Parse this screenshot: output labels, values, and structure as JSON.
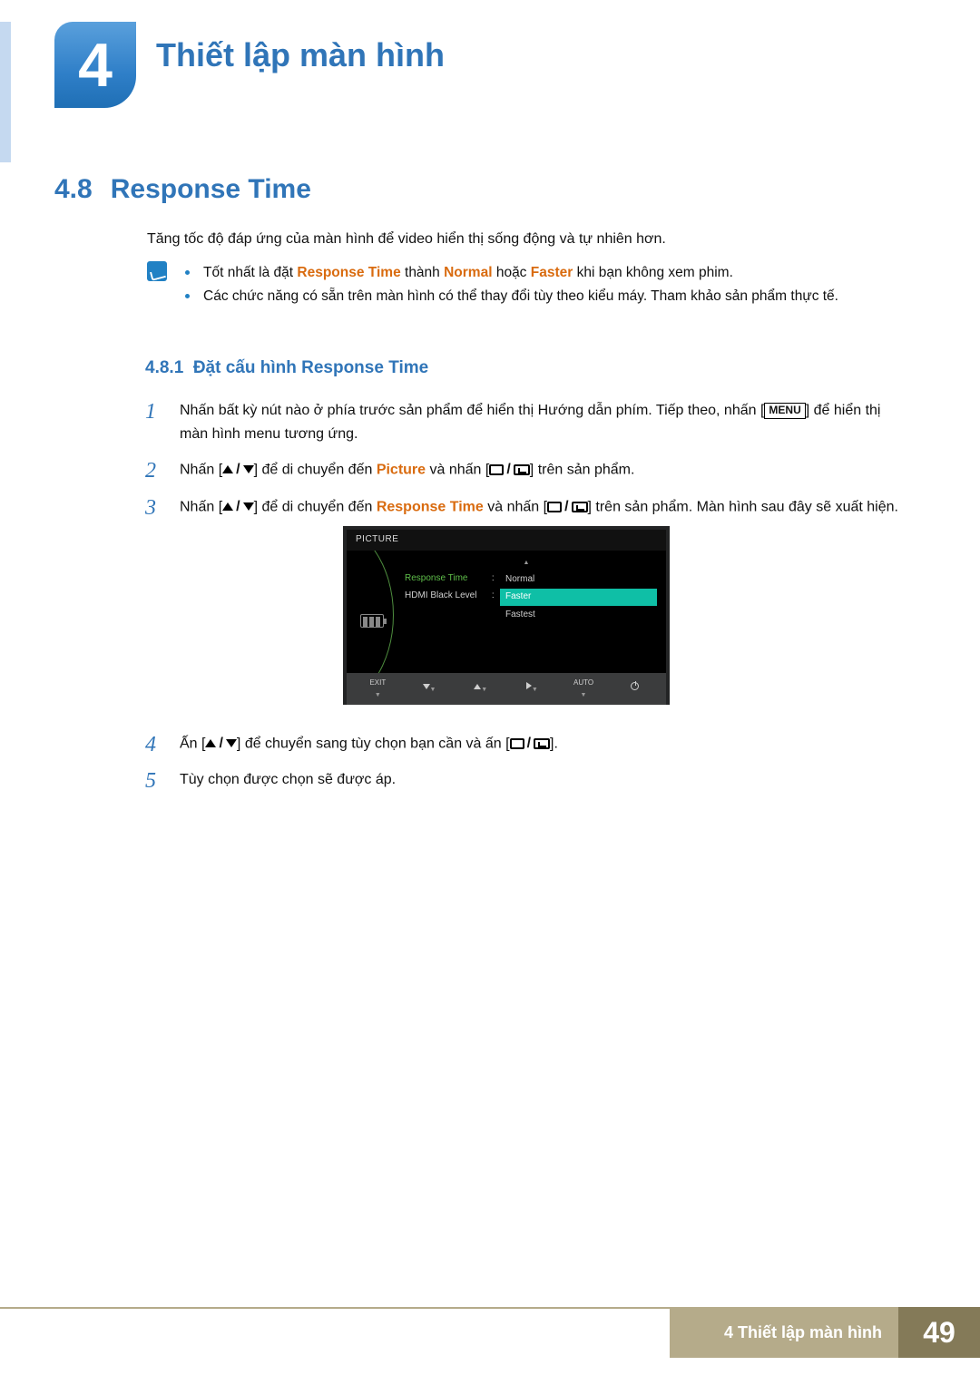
{
  "chapter": {
    "number": "4",
    "title": "Thiết lập màn hình"
  },
  "section": {
    "number": "4.8",
    "title": "Response Time"
  },
  "intro": "Tăng tốc độ đáp ứng của màn hình để video hiển thị sống động và tự nhiên hơn.",
  "note": {
    "items": [
      {
        "pre": "Tốt nhất là đặt ",
        "b1": "Response Time",
        "mid1": " thành ",
        "b2": "Normal",
        "mid2": " hoặc ",
        "b3": "Faster",
        "post": " khi bạn không xem phim."
      },
      {
        "text": "Các chức năng có sẵn trên màn hình có thể thay đổi tùy theo kiểu máy. Tham khảo sản phẩm thực tế."
      }
    ]
  },
  "subsection": {
    "number": "4.8.1",
    "title": "Đặt cấu hình Response Time"
  },
  "steps": [
    {
      "num": "1",
      "t1": "Nhấn bất kỳ nút nào ở phía trước sản phẩm để hiển thị Hướng dẫn phím. Tiếp theo, nhấn [",
      "menu": "MENU",
      "t2": "] để hiển thị màn hình menu tương ứng."
    },
    {
      "num": "2",
      "t1": "Nhấn [",
      "t2": "] để di chuyển đến ",
      "b1": "Picture",
      "t3": " và nhấn [",
      "t4": "] trên sản phẩm."
    },
    {
      "num": "3",
      "t1": "Nhấn [",
      "t2": "] để di chuyển đến ",
      "b1": "Response Time",
      "t3": " và nhấn [",
      "t4": "] trên sản phẩm. Màn hình sau đây sẽ xuất hiện."
    },
    {
      "num": "4",
      "t1": "Ấn [",
      "t2": "] để chuyển sang tùy chọn bạn cần và ấn [",
      "t3": "]."
    },
    {
      "num": "5",
      "t1": "Tùy chọn được chọn sẽ được áp."
    }
  ],
  "osd": {
    "title": "PICTURE",
    "items": [
      {
        "label": "Response Time",
        "active": true
      },
      {
        "label": "HDMI Black Level",
        "active": false
      }
    ],
    "options": [
      "Normal",
      "Faster",
      "Fastest"
    ],
    "selected": "Faster",
    "footer": {
      "exit": "EXIT",
      "auto": "AUTO"
    }
  },
  "footer": {
    "text": "4 Thiết lập màn hình",
    "page": "49"
  }
}
